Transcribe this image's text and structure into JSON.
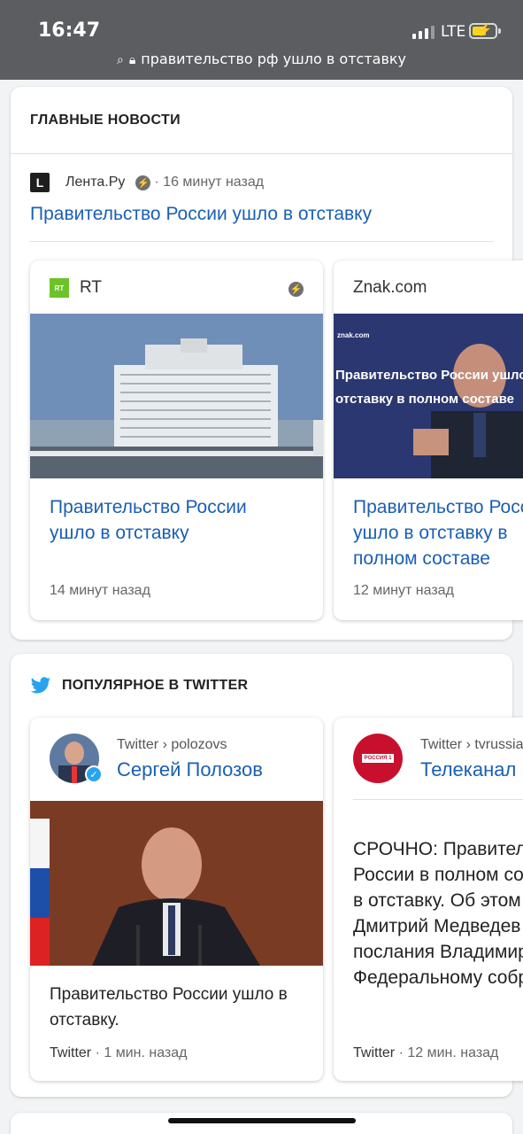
{
  "status": {
    "time": "16:47",
    "network": "LTE"
  },
  "url": {
    "text": "правительство рф ушло в отставку"
  },
  "top_news": {
    "title": "ГЛАВНЫЕ НОВОСТИ",
    "lead": {
      "source": "Лента.Ру",
      "logo": "L",
      "time": "· 16 минут назад",
      "headline": "Правительство России ушло в отставку"
    },
    "cards": [
      {
        "source": "RT",
        "logo": "RT",
        "headline": "Правительство России ушло в отставку",
        "time": "14 минут назад"
      },
      {
        "source": "Znak.com",
        "headline": "Правительство России ушло в отставку в полном составе",
        "time": "12 минут назад",
        "image_caption_site": "znak.com",
        "image_caption": "Правительство России ушло в отставку в полном составе"
      }
    ]
  },
  "twitter": {
    "title": "ПОПУЛЯРНОЕ В TWITTER",
    "cards": [
      {
        "path": "Twitter › polozovs",
        "name": "Сергей Полозов",
        "text": "Правительство России ушло в отставку.",
        "footer_source": "Twitter",
        "footer_time": "· 1 мин. назад"
      },
      {
        "path": "Twitter › tvrussia",
        "name": "Телеканал Россия",
        "logo": "РОССИЯ 1",
        "text": "СРОЧНО: Правительство России в полном составе ушло в отставку. Об этом заявил Дмитрий Медведев после послания Владимира Путина Федеральному собранию",
        "footer_source": "Twitter",
        "footer_time": "· 12 мин. назад"
      }
    ]
  },
  "colors": {
    "link": "#1a5fb4",
    "status_bar": "#5b5d60",
    "rt_green": "#6cc329",
    "verified": "#2aa3ef"
  },
  "icons": [
    "search-icon",
    "lock-icon",
    "amp-icon",
    "twitter-bird-icon",
    "verified-icon",
    "battery-icon",
    "signal-icon"
  ]
}
